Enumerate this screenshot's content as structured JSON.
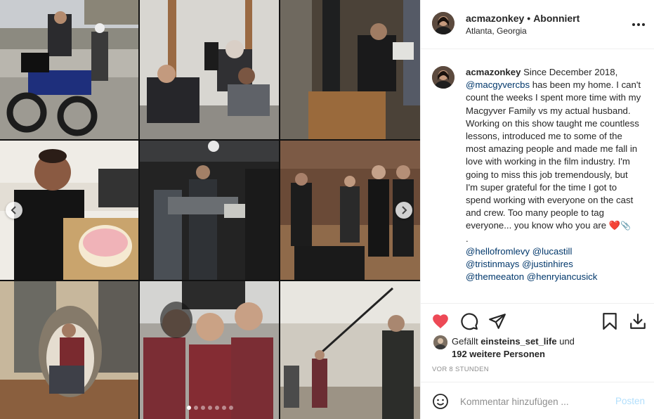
{
  "post": {
    "username": "acmazonkey",
    "separator": "•",
    "follow_status": "Abonniert",
    "location": "Atlanta, Georgia",
    "caption": {
      "username": "acmazonkey",
      "text_before_mention": "Since December 2018,",
      "mention": "@macgyvercbs",
      "text_after_mention": "has been my home. I can't count the weeks I spent more time with my Macgyver Family vs my actual husband. Working on this show taught me countless lessons, introduced me to some of the most amazing people and made me fall in love with working in the film industry. I'm going to miss this job tremendously, but I'm super grateful for the time I got to spend working with everyone on the cast and crew. Too many people to tag everyone... you know who you are",
      "emoji": "❤️",
      "period": ".",
      "tags_line1": [
        "@hellofromlevy",
        "@lucastill"
      ],
      "tags_line2": [
        "@tristinmays",
        "@justinhires"
      ],
      "tags_line3": [
        "@themeeaton",
        "@henryiancusick"
      ]
    },
    "likes": {
      "prefix": "Gefällt",
      "user": "einsteins_set_life",
      "connector": "und",
      "others": "192 weitere Personen"
    },
    "timestamp": "VOR 8 STUNDEN",
    "comment_box": {
      "placeholder": "Kommentar hinzufügen ...",
      "post_label": "Posten"
    },
    "carousel": {
      "slide_count": 7,
      "active_slide": 1
    }
  },
  "icons": {
    "like": "heart-filled-icon",
    "comment": "comment-bubble-icon",
    "share": "paper-plane-icon",
    "save": "bookmark-icon",
    "download": "download-icon",
    "more": "more-dots-icon",
    "emoji": "smiley-icon",
    "prev": "chevron-left-icon",
    "next": "chevron-right-icon"
  },
  "colors": {
    "like_red": "#ed4956",
    "mention_blue": "#00376b",
    "post_disabled_blue": "#b2dffc",
    "muted_text": "#8e8e8e",
    "divider": "#efefef"
  }
}
